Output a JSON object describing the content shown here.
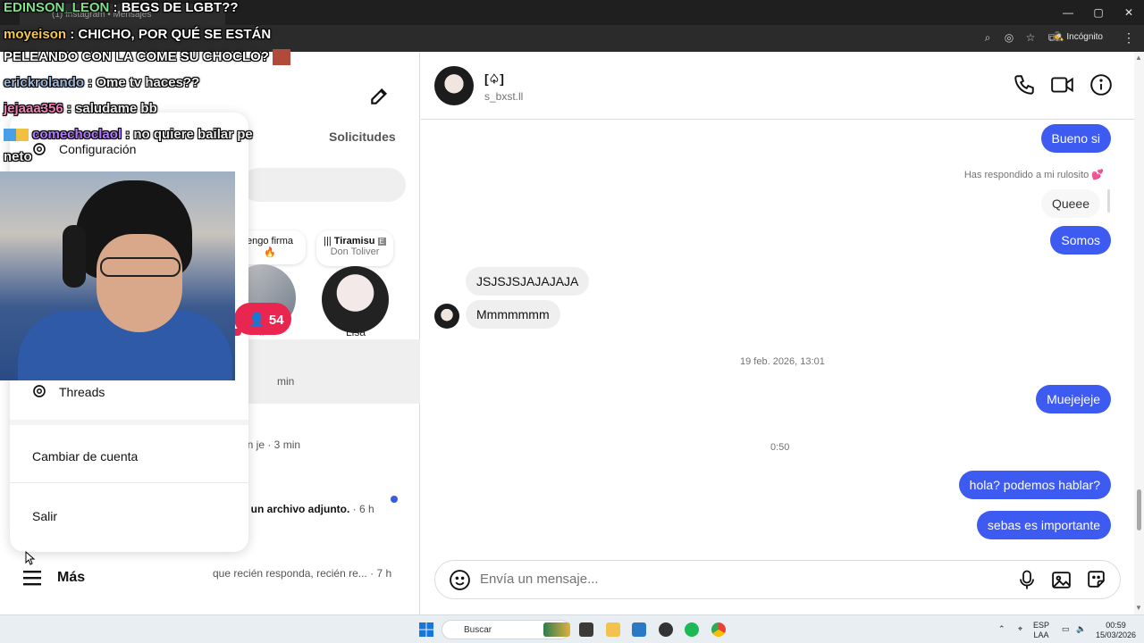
{
  "colors": {
    "accent": "#3d5af1",
    "live_badge": "#e8264f",
    "unread": "#3b5bdb"
  },
  "browser": {
    "tab_title": "(1) Instagram • Mensajes",
    "incognito_label": "Incógnito",
    "window_icons": [
      "minimize-icon",
      "maximize-icon",
      "close-icon"
    ],
    "address_icons": [
      "zoom-icon",
      "eye-off-icon",
      "star-icon",
      "extension-icon"
    ]
  },
  "stream_chat": [
    {
      "user": "EDINSON_LEON",
      "message": ": BEGS DE LGBT??"
    },
    {
      "user": "moyeison",
      "message": ": CHICHO, POR QUÉ SE ESTÁN"
    },
    {
      "user": "",
      "message": "PELEANDO CON LA COME SU CHOCLO?"
    },
    {
      "user": "erickrolando",
      "message": ": Ome tv haces??"
    },
    {
      "user": "jejaaa356",
      "message": ": saludame bb"
    },
    {
      "user": "comechoclaol",
      "message": ": no quiere bailar pe"
    },
    {
      "user": "",
      "message": "neto"
    }
  ],
  "viewer_count": "54",
  "inbox": {
    "requests_tab": "Solicitudes",
    "notes": [
      {
        "text": "engo firma",
        "emoji": "🔥"
      },
      {
        "title": "Tiramisu",
        "artist": "Don Toliver"
      }
    ],
    "stories": [
      {
        "name": "🌞"
      },
      {
        "name": "Lisa"
      }
    ],
    "rows": [
      {
        "preview": "min"
      },
      {
        "preview": "án je · 3 min"
      },
      {
        "preview": "o un archivo adjunto.",
        "time": " · 6 h"
      },
      {
        "preview": "que recién responda, recién re...",
        "time": " · 7 h"
      }
    ],
    "more_label": "Más"
  },
  "settings_menu": {
    "items": [
      {
        "label": "Configuración"
      },
      {
        "label": "Threads"
      },
      {
        "label": "Cambiar de cuenta"
      },
      {
        "label": "Salir"
      }
    ]
  },
  "conversation": {
    "name": "[♤]",
    "username": "s_bxst.ll",
    "header_icons": [
      "phone-icon",
      "video-icon",
      "info-icon"
    ],
    "messages": [
      {
        "text": "Bueno si",
        "from": "me"
      },
      {
        "text": "Has respondido a mi rulosito 💕",
        "from": "meta"
      },
      {
        "text": "Queee",
        "from": "reply"
      },
      {
        "text": "Somos",
        "from": "me"
      },
      {
        "text": "JSJSJSJAJAJAJA",
        "from": "them"
      },
      {
        "text": "Mmmmmmm",
        "from": "them"
      },
      {
        "text": "19 feb. 2026, 13:01",
        "from": "timestamp"
      },
      {
        "text": "Muejejeje",
        "from": "me"
      },
      {
        "text": "0:50",
        "from": "timestamp"
      },
      {
        "text": "hola? podemos hablar?",
        "from": "me"
      },
      {
        "text": "sebas es importante",
        "from": "me"
      }
    ],
    "composer_placeholder": "Envía un mensaje..."
  },
  "taskbar": {
    "search_label": "Buscar",
    "language": "ESP",
    "layout": "LAA",
    "time": "00:59",
    "date": "15/03/2026"
  }
}
